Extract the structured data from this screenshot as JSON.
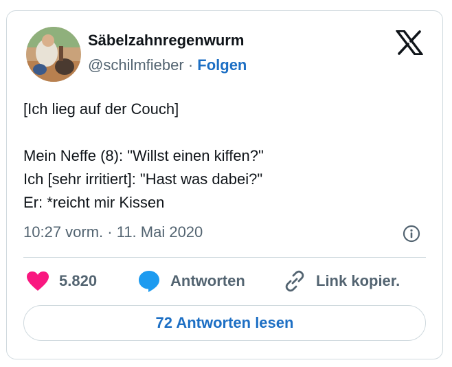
{
  "author": {
    "display_name": "Säbelzahnregenwurm",
    "handle": "@schilmfieber",
    "separator": " · ",
    "follow_label": "Folgen",
    "avatar_icon": "profile-photo"
  },
  "brand": {
    "logo_icon": "x-logo-icon"
  },
  "tweet": {
    "lines": [
      "[Ich lieg auf der Couch]",
      "",
      "Mein Neffe (8): \"Willst einen kiffen?\"",
      "Ich [sehr irritiert]: \"Hast was dabei?\"",
      "Er: *reicht mir Kissen"
    ],
    "timestamp": "10:27 vorm. · 11. Mai 2020"
  },
  "actions": {
    "like_count": "5.820",
    "reply_label": "Antworten",
    "copy_link_label": "Link kopier."
  },
  "read_replies_label": "72 Antworten lesen",
  "colors": {
    "text_primary": "#0f1419",
    "text_secondary": "#536471",
    "link_blue": "#1d6fc4",
    "heart_red": "#f91880",
    "reply_blue": "#1d9bf0",
    "border": "#cfd9de"
  }
}
